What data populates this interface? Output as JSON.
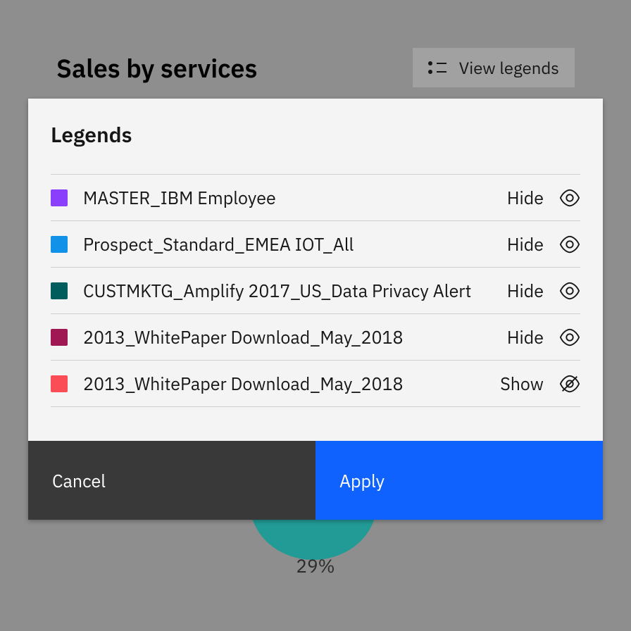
{
  "page": {
    "title": "Sales by services",
    "view_legends": "View legends",
    "donut_label": "29%"
  },
  "modal": {
    "title": "Legends",
    "cancel": "Cancel",
    "apply": "Apply",
    "items": [
      {
        "label": "MASTER_IBM Employee",
        "color": "#8a3ffc",
        "toggle": "Hide",
        "visible": true
      },
      {
        "label": "Prospect_Standard_EMEA IOT_All",
        "color": "#1192e8",
        "toggle": "Hide",
        "visible": true
      },
      {
        "label": "CUSTMKTG_Amplify 2017_US_Data Privacy Alert",
        "color": "#005d5d",
        "toggle": "Hide",
        "visible": true
      },
      {
        "label": "2013_WhitePaper Download_May_2018",
        "color": "#9f1853",
        "toggle": "Hide",
        "visible": true
      },
      {
        "label": "2013_WhitePaper Download_May_2018",
        "color": "#fa4d56",
        "toggle": "Show",
        "visible": false
      }
    ]
  }
}
